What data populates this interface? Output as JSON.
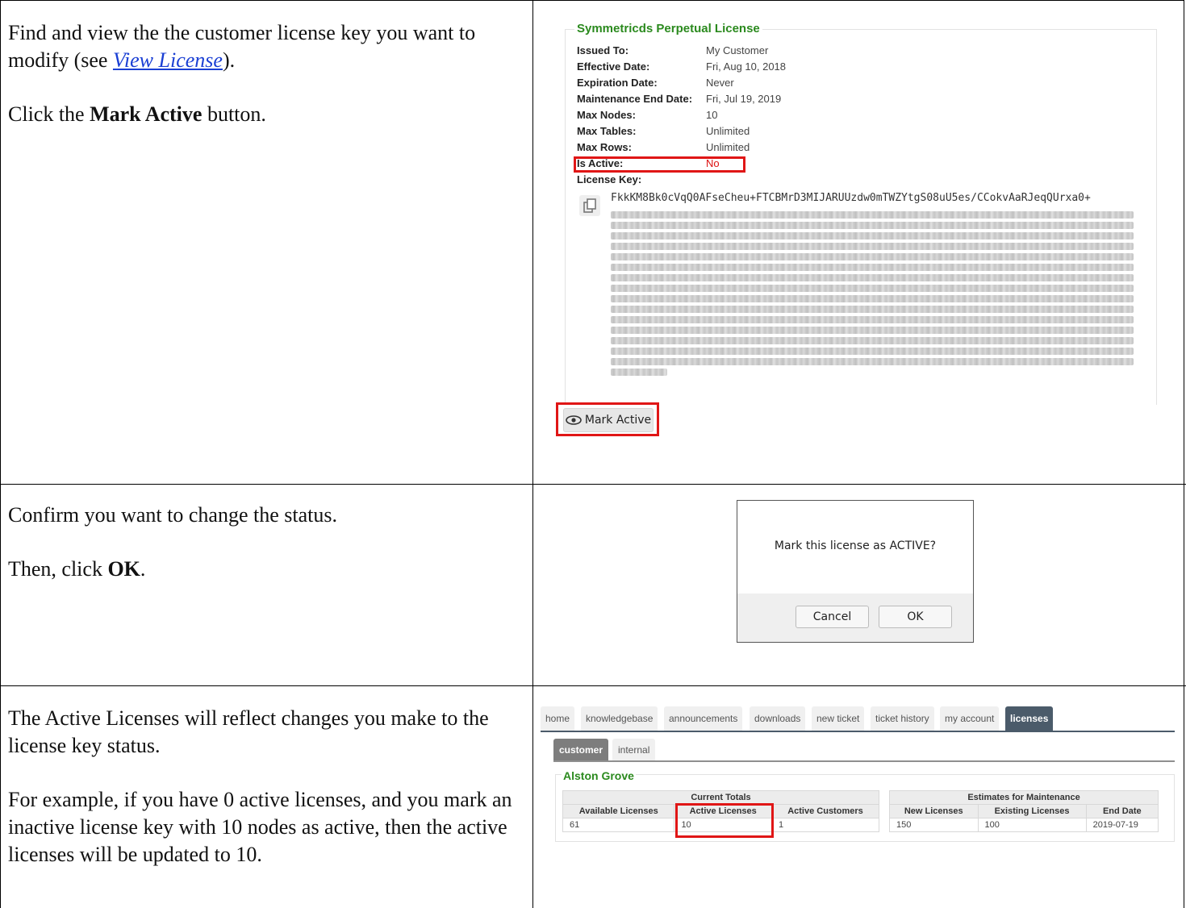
{
  "rows": [
    {
      "para1": {
        "before": "Find and view the the customer license key you want to modify (see ",
        "link": "View License",
        "after": ")."
      },
      "para2": {
        "before": "Click the ",
        "bold": "Mark Active",
        "after": " button."
      },
      "license": {
        "title": "Symmetricds Perpetual License",
        "fields": [
          {
            "label": "Issued To:",
            "value": "My Customer"
          },
          {
            "label": "Effective Date:",
            "value": "Fri, Aug 10, 2018"
          },
          {
            "label": "Expiration Date:",
            "value": "Never"
          },
          {
            "label": "Maintenance End Date:",
            "value": "Fri, Jul 19, 2019"
          },
          {
            "label": "Max Nodes:",
            "value": "10"
          },
          {
            "label": "Max Tables:",
            "value": "Unlimited"
          },
          {
            "label": "Max Rows:",
            "value": "Unlimited"
          },
          {
            "label": "Is Active:",
            "value": "No"
          }
        ],
        "key_label": "License Key:",
        "key_first_line": "FkkKM8Bk0cVqQ0AFseCheu+FTCBMrD3MIJARUUzdw0mTWZYtgS08uU5es/CCokvAaRJeqQUrxa0+",
        "mark_active_label": "Mark Active"
      }
    },
    {
      "para1": "Confirm you want to change the status.",
      "para2": {
        "before": "Then, click ",
        "bold": "OK",
        "after": "."
      },
      "dialog": {
        "message": "Mark this license as ACTIVE?",
        "cancel": "Cancel",
        "ok": "OK"
      }
    },
    {
      "para1": "The Active Licenses will reflect changes you make to the license key status.",
      "para2": "For example, if you have 0 active licenses, and you mark an inactive license key with 10 nodes as active, then the active licenses will be updated to 10.",
      "portal": {
        "tabs": [
          "home",
          "knowledgebase",
          "announcements",
          "downloads",
          "new ticket",
          "ticket history",
          "my account",
          "licenses"
        ],
        "active_tab": "licenses",
        "subtabs": [
          "customer",
          "internal"
        ],
        "active_subtab": "customer",
        "customer_name": "Alston Grove",
        "current_totals": {
          "caption": "Current Totals",
          "headers": [
            "Available Licenses",
            "Active Licenses",
            "Active Customers"
          ],
          "values": [
            "61",
            "10",
            "1"
          ]
        },
        "estimates": {
          "caption": "Estimates for Maintenance",
          "headers": [
            "New Licenses",
            "Existing Licenses",
            "End Date"
          ],
          "values": [
            "150",
            "100",
            "2019-07-19"
          ]
        }
      }
    }
  ],
  "colors": {
    "accent_green": "#2b8a1e",
    "highlight_red": "#e01616",
    "link_blue": "#1a3fd4"
  }
}
